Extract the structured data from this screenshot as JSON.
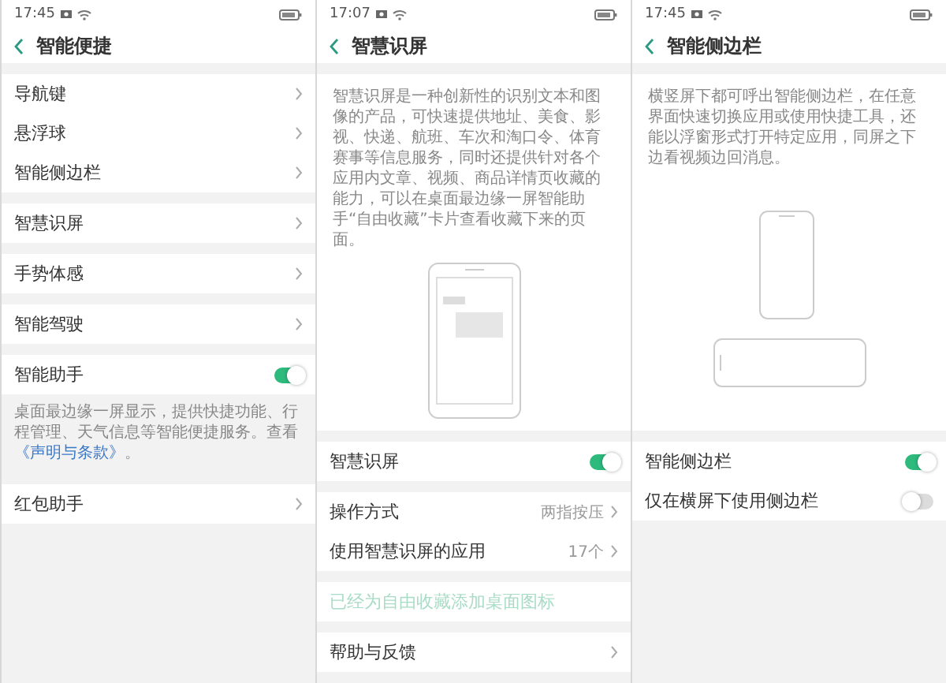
{
  "screens": [
    {
      "status_bar": {
        "time": "17:45"
      },
      "title": "智能便捷",
      "sections": [
        {
          "items": [
            {
              "kind": "nav",
              "label": "导航键"
            },
            {
              "kind": "nav",
              "label": "悬浮球"
            },
            {
              "kind": "nav",
              "label": "智能侧边栏"
            }
          ]
        },
        {
          "items": [
            {
              "kind": "nav",
              "label": "智慧识屏"
            }
          ]
        },
        {
          "items": [
            {
              "kind": "nav",
              "label": "手势体感"
            }
          ]
        },
        {
          "items": [
            {
              "kind": "nav",
              "label": "智能驾驶"
            }
          ]
        },
        {
          "items": [
            {
              "kind": "switch",
              "label": "智能助手",
              "on": true
            },
            {
              "kind": "note",
              "text": "桌面最边缘一屏显示，提供快捷功能、行程管理、天气信息等智能便捷服务。查看",
              "link": "《声明与条款》",
              "after": "。"
            }
          ]
        },
        {
          "items": [
            {
              "kind": "nav",
              "label": "红包助手"
            }
          ]
        }
      ]
    },
    {
      "status_bar": {
        "time": "17:07"
      },
      "title": "智慧识屏",
      "sections": [
        {
          "items": [
            {
              "kind": "intro",
              "text": "智慧识屏是一种创新性的识别文本和图像的产品，可快速提供地址、美食、影视、快递、航班、车次和淘口令、体育赛事等信息服务，同时还提供针对各个应用内文章、视频、商品详情页收藏的能力，可以在桌面最边缘一屏智能助手“自由收藏”卡片查看收藏下来的页面。",
              "figure": {
                "kind": "screen-mockup"
              }
            }
          ]
        },
        {
          "items": [
            {
              "kind": "switch",
              "label": "智慧识屏",
              "on": true
            }
          ]
        },
        {
          "items": [
            {
              "kind": "nav",
              "label": "操作方式",
              "value": "两指按压"
            },
            {
              "kind": "nav",
              "label": "使用智慧识屏的应用",
              "value": "17个"
            }
          ]
        },
        {
          "items": [
            {
              "kind": "action",
              "label": "已经为自由收藏添加桌面图标",
              "disabled": true
            }
          ]
        },
        {
          "items": [
            {
              "kind": "nav",
              "label": "帮助与反馈"
            }
          ]
        }
      ]
    },
    {
      "status_bar": {
        "time": "17:45"
      },
      "title": "智能侧边栏",
      "sections": [
        {
          "items": [
            {
              "kind": "intro",
              "text": "横竖屏下都可呼出智能侧边栏，在任意界面快速切换应用或使用快捷工具，还能以浮窗形式打开特定应用，同屏之下边看视频边回消息。",
              "figure": {
                "kind": "portrait-landscape"
              }
            }
          ]
        },
        {
          "items": [
            {
              "kind": "switch",
              "label": "智能侧边栏",
              "on": true
            },
            {
              "kind": "switch",
              "label": "仅在横屏下使用侧边栏",
              "on": false
            }
          ]
        }
      ]
    }
  ]
}
